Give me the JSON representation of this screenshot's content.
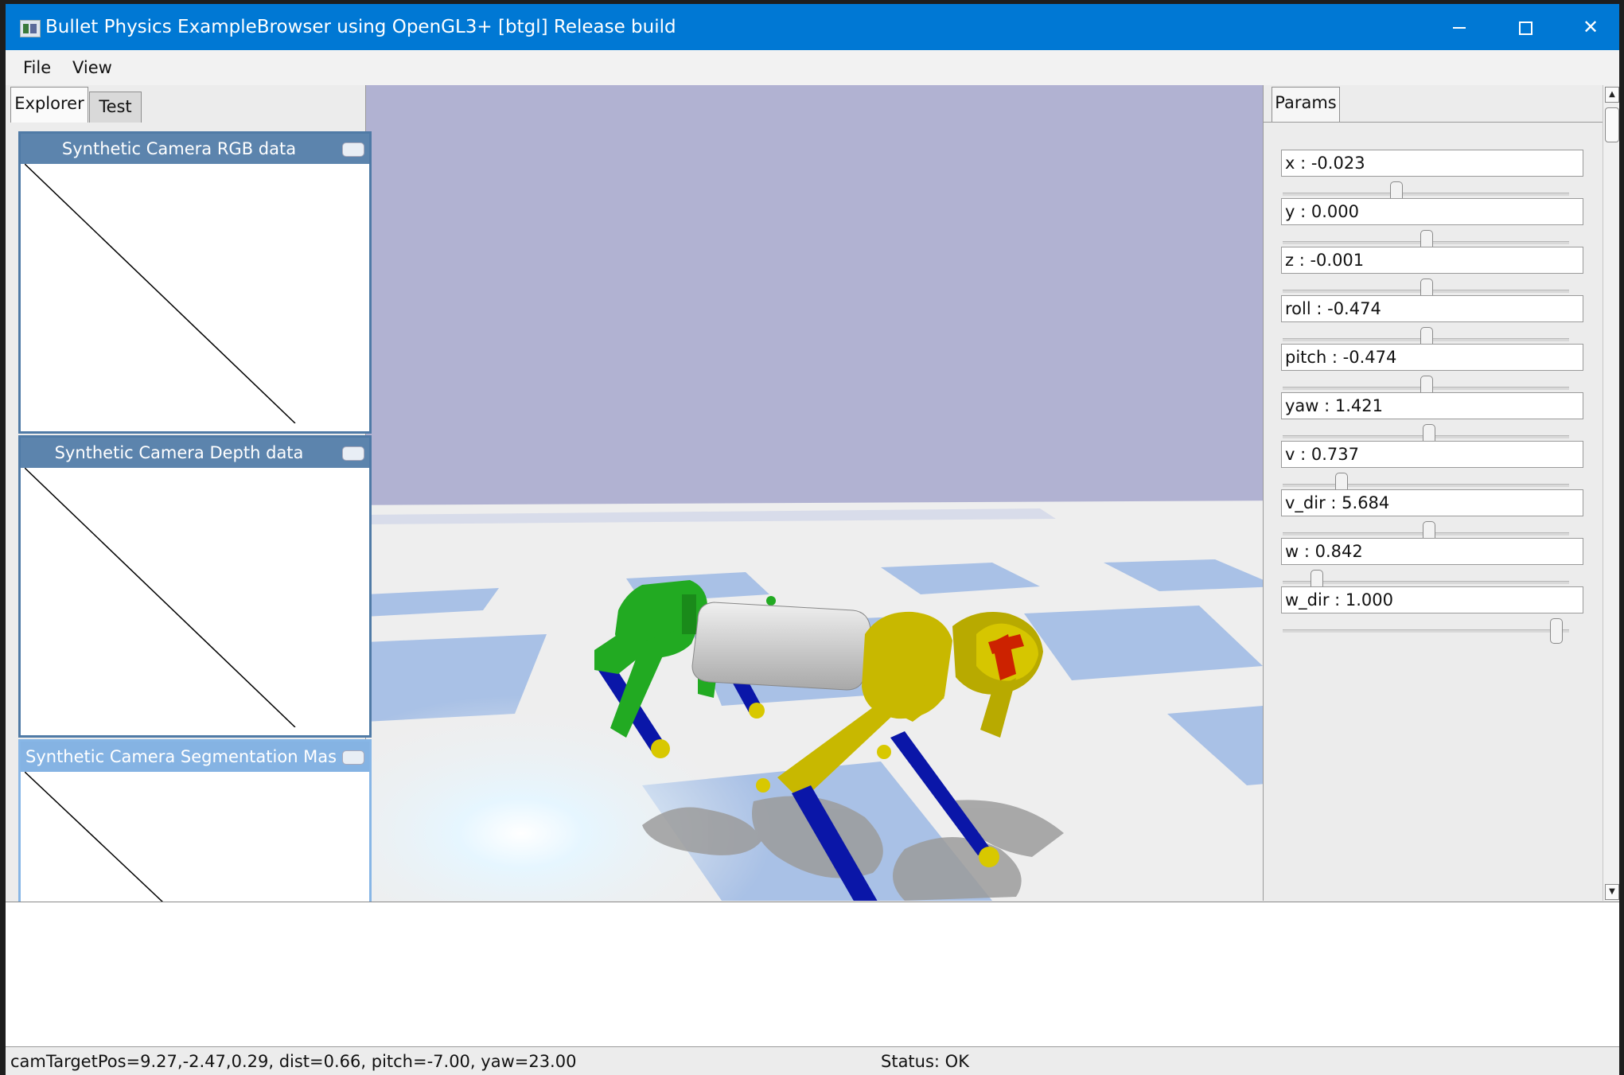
{
  "window": {
    "title": "Bullet Physics ExampleBrowser using OpenGL3+ [btgl] Release build"
  },
  "menu": {
    "file": "File",
    "view": "View"
  },
  "left_tabs": {
    "explorer": "Explorer",
    "test": "Test"
  },
  "camera_windows": [
    {
      "title": "Synthetic Camera RGB data"
    },
    {
      "title": "Synthetic Camera Depth data"
    },
    {
      "title": "Synthetic Camera Segmentation Mask"
    }
  ],
  "params": {
    "tab": "Params",
    "sliders": [
      {
        "label": "x : -0.023",
        "fraction": 0.39
      },
      {
        "label": "y : 0.000",
        "fraction": 0.5
      },
      {
        "label": "z : -0.001",
        "fraction": 0.5
      },
      {
        "label": "roll : -0.474",
        "fraction": 0.5
      },
      {
        "label": "pitch : -0.474",
        "fraction": 0.5
      },
      {
        "label": "yaw : 1.421",
        "fraction": 0.51
      },
      {
        "label": "v : 0.737",
        "fraction": 0.19
      },
      {
        "label": "v_dir : 5.684",
        "fraction": 0.51
      },
      {
        "label": "w : 0.842",
        "fraction": 0.1
      },
      {
        "label": "w_dir : 1.000",
        "fraction": 0.97
      }
    ]
  },
  "status": {
    "camera": "camTargetPos=9.27,-2.47,0.29, dist=0.66, pitch=-7.00, yaw=23.00",
    "state": "Status: OK"
  },
  "scene": {
    "sky_color": "#b1b2d2",
    "floor_light": "#eeeeee",
    "floor_blue": "#a9c1e6",
    "robot_front_color": "#c8b800",
    "robot_rear_color": "#22aa22",
    "robot_body_color": "#d4d4d4",
    "leg_color": "#0a16a8",
    "foot_color": "#d8c800"
  }
}
